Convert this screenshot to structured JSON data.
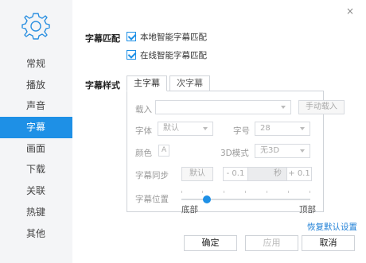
{
  "window": {
    "close_symbol": "×"
  },
  "sidebar": {
    "items": [
      {
        "label": "常规"
      },
      {
        "label": "播放"
      },
      {
        "label": "声音"
      },
      {
        "label": "字幕"
      },
      {
        "label": "画面"
      },
      {
        "label": "下载"
      },
      {
        "label": "关联"
      },
      {
        "label": "热键"
      },
      {
        "label": "其他"
      }
    ],
    "active_index": 3
  },
  "subtitle_match": {
    "section_label": "字幕匹配",
    "options": [
      {
        "label": "本地智能字幕匹配",
        "checked": true
      },
      {
        "label": "在线智能字幕匹配",
        "checked": true
      }
    ]
  },
  "subtitle_style": {
    "section_label": "字幕样式",
    "tabs": [
      {
        "label": "主字幕"
      },
      {
        "label": "次字幕"
      }
    ],
    "active_tab": 0,
    "load": {
      "label": "载入",
      "value": "",
      "button": "手动载入"
    },
    "font": {
      "label": "字体",
      "value": "默认"
    },
    "size": {
      "label": "字号",
      "value": "28"
    },
    "color": {
      "label": "颜色",
      "swatch": "A"
    },
    "mode3d": {
      "label": "3D模式",
      "value": "无3D"
    },
    "sync": {
      "label": "字幕同步",
      "default_button": "默认",
      "minus": "- 0.1",
      "unit": "秒",
      "plus": "+ 0.1"
    },
    "position": {
      "label": "字幕位置",
      "left": "底部",
      "right": "顶部",
      "value_fraction": 0.2
    }
  },
  "footer": {
    "restore_link": "恢复默认设置",
    "ok": "确定",
    "apply": "应用",
    "cancel": "取消"
  },
  "colors": {
    "accent": "#1e90e6",
    "link": "#1e7fd6"
  }
}
